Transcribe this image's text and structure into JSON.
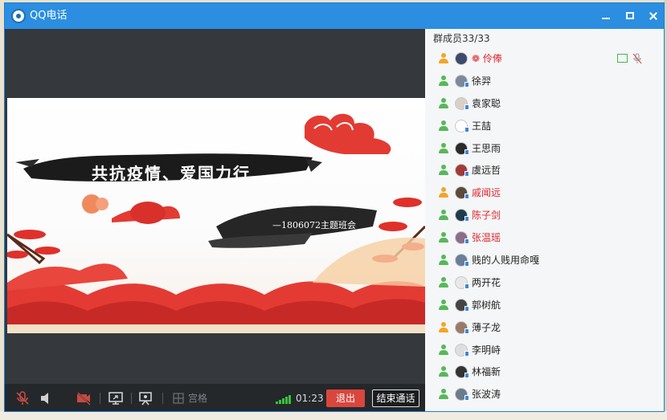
{
  "window": {
    "title": "QQ电话"
  },
  "slide": {
    "title": "共抗疫情、爱国力行",
    "subtitle": "—1806072主题班会"
  },
  "toolbar": {
    "grid_label": "宫格",
    "timer": "01:23",
    "exit_label": "退出",
    "end_label": "结束通话"
  },
  "members": {
    "header": "群成员33/33",
    "items": [
      {
        "name": "伶俸",
        "color": "#e0262c",
        "prefix": "❁"
      },
      {
        "name": "徐羿",
        "color": "#222222"
      },
      {
        "name": "袁家聪",
        "color": "#222222"
      },
      {
        "name": "王喆",
        "color": "#222222"
      },
      {
        "name": "王思雨",
        "color": "#222222"
      },
      {
        "name": "虞远哲",
        "color": "#222222"
      },
      {
        "name": "戚闻远",
        "color": "#e0262c"
      },
      {
        "name": "陈子剑",
        "color": "#e0262c"
      },
      {
        "name": "张温瑶",
        "color": "#e0262c"
      },
      {
        "name": "贱的人贱用命嘎",
        "color": "#222222"
      },
      {
        "name": "两开花",
        "color": "#222222"
      },
      {
        "name": "郭树航",
        "color": "#222222"
      },
      {
        "name": "薄子龙",
        "color": "#222222"
      },
      {
        "name": "李明峙",
        "color": "#222222"
      },
      {
        "name": "林福新",
        "color": "#222222"
      },
      {
        "name": "张波涛",
        "color": "#222222"
      }
    ]
  },
  "colors": {
    "titlebar": "#2b8ee0",
    "exit_button": "#d9463e",
    "signal": "#39c23b",
    "host_user_icon": "#f3a52a",
    "member_user_icon": "#57b85a"
  }
}
